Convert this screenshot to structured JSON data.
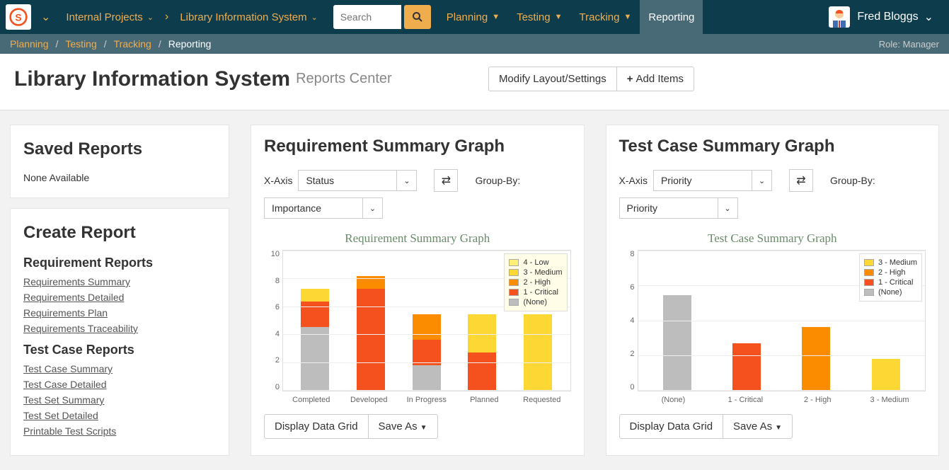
{
  "nav": {
    "workspace": "Internal Projects",
    "project": "Library Information System",
    "search_placeholder": "Search",
    "menus": {
      "planning": "Planning",
      "testing": "Testing",
      "tracking": "Tracking",
      "reporting": "Reporting"
    },
    "user": "Fred Bloggs"
  },
  "breadcrumb": {
    "items": [
      "Planning",
      "Testing",
      "Tracking"
    ],
    "current": "Reporting",
    "role": "Role: Manager"
  },
  "header": {
    "title": "Library Information System",
    "subtitle": "Reports Center",
    "modify": "Modify Layout/Settings",
    "add": "Add Items"
  },
  "sidebar": {
    "saved_title": "Saved Reports",
    "none": "None Available",
    "create_title": "Create Report",
    "sec1": "Requirement Reports",
    "r1": "Requirements Summary",
    "r2": "Requirements Detailed",
    "r3": "Requirements Plan",
    "r4": "Requirements Traceability",
    "sec2": "Test Case Reports",
    "t1": "Test Case Summary",
    "t2": "Test Case Detailed",
    "t3": "Test Set Summary",
    "t4": "Test Set Detailed",
    "t5": "Printable Test Scripts"
  },
  "graph1": {
    "title": "Requirement Summary Graph",
    "xaxis_label": "X-Axis",
    "xaxis_value": "Status",
    "groupby_label": "Group-By:",
    "groupby_value": "Importance",
    "display": "Display Data Grid",
    "saveas": "Save As"
  },
  "graph2": {
    "title": "Test Case Summary Graph",
    "xaxis_label": "X-Axis",
    "xaxis_value": "Priority",
    "groupby_label": "Group-By:",
    "groupby_value": "Priority",
    "display": "Display Data Grid",
    "saveas": "Save As"
  },
  "chart_data": [
    {
      "type": "bar",
      "title": "Requirement Summary Graph",
      "xlabel": "",
      "ylabel": "",
      "ylim": [
        0,
        10
      ],
      "yticks": [
        0,
        2,
        4,
        6,
        8,
        10
      ],
      "categories": [
        "Completed",
        "Developed",
        "In Progress",
        "Planned",
        "Requested"
      ],
      "series": [
        {
          "name": "4 - Low",
          "color": "#fff176",
          "values": [
            0,
            0,
            0,
            0,
            0
          ]
        },
        {
          "name": "3 - Medium",
          "color": "#fdd835",
          "values": [
            1,
            0,
            0,
            3,
            6
          ]
        },
        {
          "name": "2 - High",
          "color": "#fb8c00",
          "values": [
            0,
            1,
            2,
            0,
            0
          ]
        },
        {
          "name": "1 - Critical",
          "color": "#f4511e",
          "values": [
            2,
            8,
            2,
            3,
            0
          ]
        },
        {
          "name": "(None)",
          "color": "#bdbdbd",
          "values": [
            5,
            0,
            2,
            0,
            0
          ]
        }
      ]
    },
    {
      "type": "bar",
      "title": "Test Case Summary Graph",
      "xlabel": "",
      "ylabel": "",
      "ylim": [
        0,
        8
      ],
      "yticks": [
        0,
        2,
        4,
        6,
        8
      ],
      "categories": [
        "(None)",
        "1 - Critical",
        "2 - High",
        "3 - Medium"
      ],
      "series": [
        {
          "name": "3 - Medium",
          "color": "#fdd835",
          "values": [
            0,
            0,
            0,
            2
          ]
        },
        {
          "name": "2 - High",
          "color": "#fb8c00",
          "values": [
            0,
            0,
            4,
            0
          ]
        },
        {
          "name": "1 - Critical",
          "color": "#f4511e",
          "values": [
            0,
            3,
            0,
            0
          ]
        },
        {
          "name": "(None)",
          "color": "#bdbdbd",
          "values": [
            6,
            0,
            0,
            0
          ]
        }
      ]
    }
  ]
}
